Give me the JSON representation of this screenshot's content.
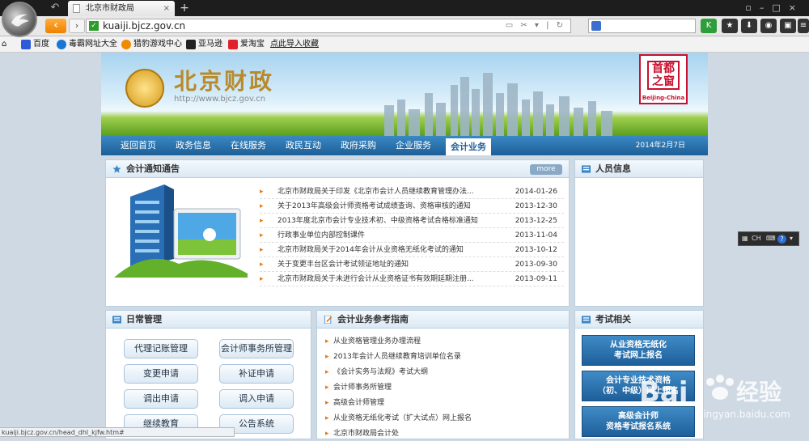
{
  "browser": {
    "tab_title": "北京市财政局",
    "url": "kuaiji.bjcz.gov.cn",
    "bookmarks": [
      {
        "label": "百度",
        "color": "#2e5bd8"
      },
      {
        "label": "毒霸网址大全",
        "color": "#1976d2"
      },
      {
        "label": "猎豹游戏中心",
        "color": "#f08a00"
      },
      {
        "label": "亚马逊",
        "color": "#222222"
      },
      {
        "label": "爱淘宝",
        "color": "#e0202a"
      },
      {
        "label": "点此导入收藏",
        "color": ""
      }
    ],
    "status_url": "kuaiji.bjcz.gov.cn/head_dhl_kjfw.htm#",
    "ime_label": "CH"
  },
  "site": {
    "title": "北京财政",
    "url_text": "http://www.bjcz.gov.cn",
    "capital_seal": "首都之窗",
    "capital_caption": "Beijing-China",
    "date": "2014年2月7日"
  },
  "nav": [
    "返回首页",
    "政务信息",
    "在线服务",
    "政民互动",
    "政府采购",
    "企业服务",
    "会计业务"
  ],
  "notices": {
    "title": "会计通知通告",
    "more": "more",
    "items": [
      {
        "title": "北京市财政局关于印发《北京市会计人员继续教育管理办法...",
        "date": "2014-01-26"
      },
      {
        "title": "关于2013年高级会计师资格考试成绩查询、资格审核的通知",
        "date": "2013-12-30"
      },
      {
        "title": "2013年度北京市会计专业技术初、中级资格考试合格标准通知",
        "date": "2013-12-25"
      },
      {
        "title": "行政事业单位内部控制课件",
        "date": "2013-11-04"
      },
      {
        "title": "北京市财政局关于2014年会计从业资格无纸化考试的通知",
        "date": "2013-10-12"
      },
      {
        "title": "关于变更丰台区会计考试领证地址的通知",
        "date": "2013-09-30"
      },
      {
        "title": "北京市财政局关于未进行会计从业资格证书有效期延期注册...",
        "date": "2013-09-11"
      }
    ]
  },
  "personnel": {
    "title": "人员信息"
  },
  "daily": {
    "title": "日常管理",
    "buttons": [
      "代理记账管理",
      "会计师事务所管理",
      "变更申请",
      "补证申请",
      "调出申请",
      "调入申请",
      "继续教育",
      "公告系统"
    ]
  },
  "guide": {
    "title": "会计业务参考指南",
    "items": [
      "从业资格管理业务办理流程",
      "2013年会计人员继续教育培训单位名录",
      "《会计实务与法规》考试大纲",
      "会计师事务所管理",
      "高级会计师管理",
      "从业资格无纸化考试（扩大试点）网上报名",
      "北京市财政局会计处"
    ]
  },
  "exam": {
    "title": "考试相关",
    "buttons": [
      {
        "line1": "从业资格无纸化",
        "line2": "考试网上报名"
      },
      {
        "line1": "会计专业技术资格",
        "line2": "（初、中级）网上报名"
      },
      {
        "line1": "高级会计师",
        "line2": "资格考试报名系统"
      }
    ]
  },
  "watermark": {
    "brand": "Bai",
    "brand2": "经验",
    "sub": "jingyan.baidu.com"
  },
  "colors": {
    "nav_blue": "#1d5f97",
    "accent_orange": "#f08000",
    "bullet": "#e77b1a"
  }
}
